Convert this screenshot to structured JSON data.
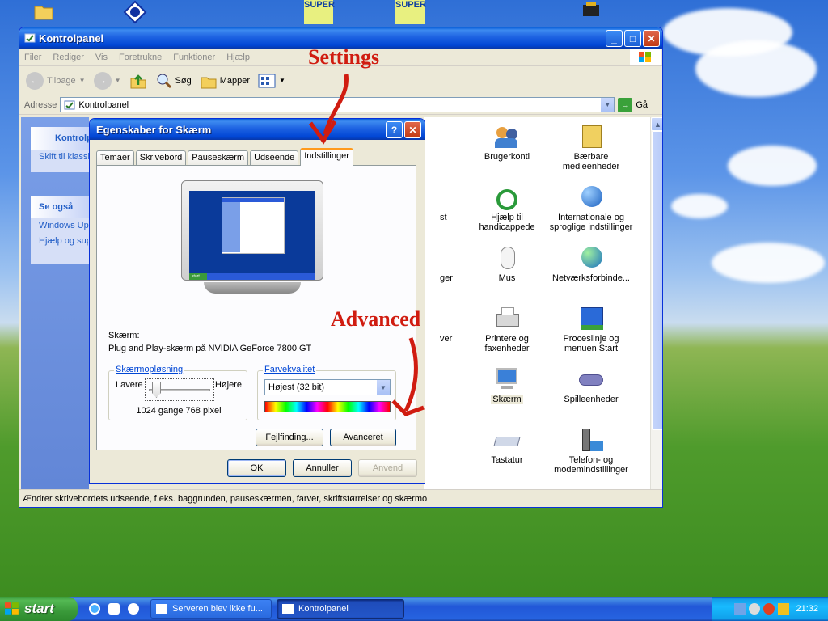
{
  "colors": {
    "accent": "#0046d5",
    "annotation": "#d01c10",
    "link": "#215dc6"
  },
  "desktop": {
    "icons": [
      "folder-icon",
      "info-icon",
      "super-icon",
      "super-icon",
      "chip-icon"
    ],
    "icon_labels": {
      "super": "SUPER"
    }
  },
  "annotations": {
    "settings": "Settings",
    "advanced": "Advanced"
  },
  "control_panel": {
    "title": "Kontrolpanel",
    "menu": [
      "Filer",
      "Rediger",
      "Vis",
      "Foretrukne",
      "Funktioner",
      "Hjælp"
    ],
    "toolbar": {
      "back": "Tilbage",
      "search": "Søg",
      "folders": "Mapper"
    },
    "address_label": "Adresse",
    "address_value": "Kontrolpanel",
    "go_label": "Gå",
    "left": {
      "header": "Kontrolpanel",
      "switch": "Skift til klassisk visning",
      "see_also": "Se også",
      "windows_update": "Windows Update",
      "help": "Hjælp og support"
    },
    "items": [
      {
        "label": "Brugerkonti",
        "icon": "users-icon"
      },
      {
        "label": "Bærbare medieenheder",
        "icon": "portable-media-icon"
      },
      {
        "label": "Hjælp til handicappede",
        "icon": "accessibility-icon"
      },
      {
        "label": "Internationale og sproglige indstillinger",
        "icon": "globe-icon"
      },
      {
        "label": "Mus",
        "icon": "mouse-icon"
      },
      {
        "label": "Netværksforbinde...",
        "icon": "network-icon"
      },
      {
        "label": "Printere og faxenheder",
        "icon": "printer-icon"
      },
      {
        "label": "Proceslinje og menuen Start",
        "icon": "taskbar-icon"
      },
      {
        "label": "Skærm",
        "icon": "display-icon"
      },
      {
        "label": "Spilleenheder",
        "icon": "gamepad-icon"
      },
      {
        "label": "Tastatur",
        "icon": "keyboard-icon"
      },
      {
        "label": "Telefon- og modemindstillinger",
        "icon": "phone-icon"
      }
    ],
    "partial_labels": [
      "st",
      "ger",
      "ver"
    ],
    "status": "Ændrer skrivebordets udseende, f.eks. baggrunden, pauseskærmen, farver, skriftstørrelser og skærmo"
  },
  "dialog": {
    "title": "Egenskaber for Skærm",
    "tabs": [
      "Temaer",
      "Skrivebord",
      "Pauseskærm",
      "Udseende",
      "Indstillinger"
    ],
    "active_tab": "Indstillinger",
    "display_label": "Skærm:",
    "display_value": "Plug and Play-skærm på NVIDIA GeForce 7800 GT",
    "resolution": {
      "title": "Skærmopløsning",
      "low": "Lavere",
      "high": "Højere",
      "value": "1024 gange 768 pixel"
    },
    "color": {
      "title": "Farvekvalitet",
      "value": "Højest (32 bit)"
    },
    "preview": {
      "start": "start"
    },
    "buttons": {
      "troubleshoot": "Fejlfinding...",
      "advanced": "Avanceret",
      "ok": "OK",
      "cancel": "Annuller",
      "apply": "Anvend"
    }
  },
  "taskbar": {
    "start": "start",
    "tasks": [
      "Serveren blev ikke fu...",
      "Kontrolpanel"
    ],
    "clock": "21:32"
  }
}
